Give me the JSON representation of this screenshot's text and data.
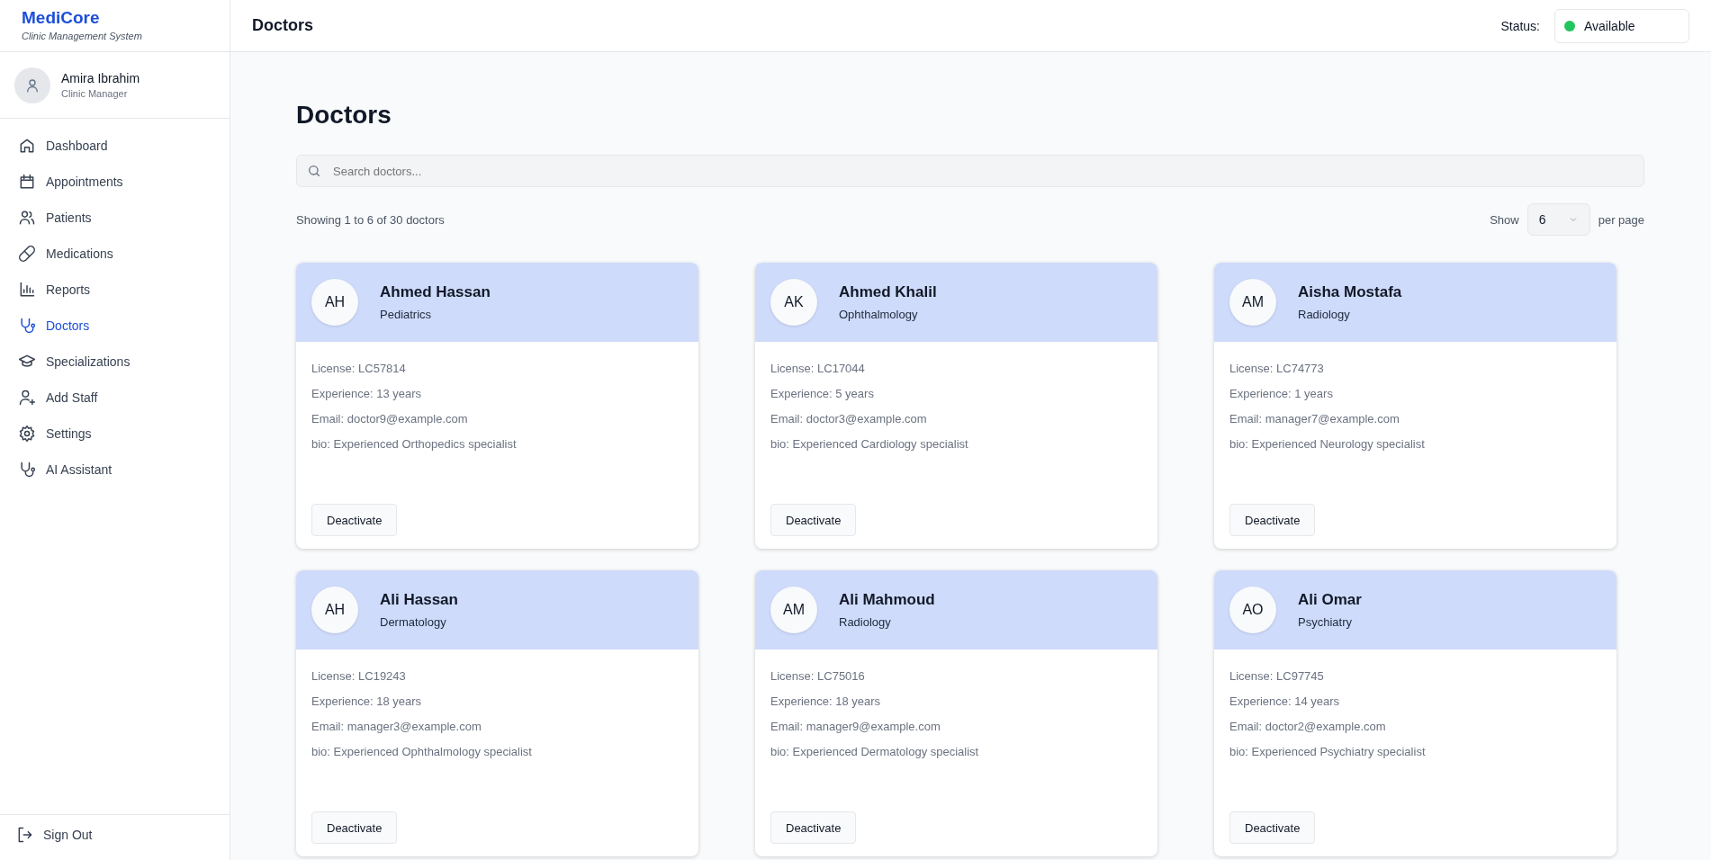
{
  "brand": {
    "name": "MediCore",
    "tagline": "Clinic Management System"
  },
  "user": {
    "name": "Amira Ibrahim",
    "role": "Clinic Manager"
  },
  "nav": [
    {
      "label": "Dashboard",
      "selected": false
    },
    {
      "label": "Appointments",
      "selected": false
    },
    {
      "label": "Patients",
      "selected": false
    },
    {
      "label": "Medications",
      "selected": false
    },
    {
      "label": "Reports",
      "selected": false
    },
    {
      "label": "Doctors",
      "selected": true
    },
    {
      "label": "Specializations",
      "selected": false
    },
    {
      "label": "Add Staff",
      "selected": false
    },
    {
      "label": "Settings",
      "selected": false
    },
    {
      "label": "AI Assistant",
      "selected": false
    }
  ],
  "sign_out": "Sign Out",
  "header": {
    "title": "Doctors",
    "status_label": "Status:",
    "status": {
      "text": "Available",
      "color": "#22c55e"
    }
  },
  "page_title": "Doctors",
  "search": {
    "placeholder": "Search doctors..."
  },
  "showing": "Showing 1 to 6 of 30 doctors",
  "pagination": {
    "show": "Show",
    "value": "6",
    "per_page": "per page"
  },
  "doctors": [
    {
      "initials": "AH",
      "name": "Ahmed Hassan",
      "specialty": "Pediatrics",
      "license": "License: LC57814",
      "experience": "Experience: 13 years",
      "email": "Email: doctor9@example.com",
      "bio": "bio: Experienced Orthopedics specialist",
      "action": "Deactivate"
    },
    {
      "initials": "AK",
      "name": "Ahmed Khalil",
      "specialty": "Ophthalmology",
      "license": "License: LC17044",
      "experience": "Experience: 5 years",
      "email": "Email: doctor3@example.com",
      "bio": "bio: Experienced Cardiology specialist",
      "action": "Deactivate"
    },
    {
      "initials": "AM",
      "name": "Aisha Mostafa",
      "specialty": "Radiology",
      "license": "License: LC74773",
      "experience": "Experience: 1 years",
      "email": "Email: manager7@example.com",
      "bio": "bio: Experienced Neurology specialist",
      "action": "Deactivate"
    },
    {
      "initials": "AH",
      "name": "Ali Hassan",
      "specialty": "Dermatology",
      "license": "License: LC19243",
      "experience": "Experience: 18 years",
      "email": "Email: manager3@example.com",
      "bio": "bio: Experienced Ophthalmology specialist",
      "action": "Deactivate"
    },
    {
      "initials": "AM",
      "name": "Ali Mahmoud",
      "specialty": "Radiology",
      "license": "License: LC75016",
      "experience": "Experience: 18 years",
      "email": "Email: manager9@example.com",
      "bio": "bio: Experienced Dermatology specialist",
      "action": "Deactivate"
    },
    {
      "initials": "AO",
      "name": "Ali Omar",
      "specialty": "Psychiatry",
      "license": "License: LC97745",
      "experience": "Experience: 14 years",
      "email": "Email: doctor2@example.com",
      "bio": "bio: Experienced Psychiatry specialist",
      "action": "Deactivate"
    }
  ]
}
